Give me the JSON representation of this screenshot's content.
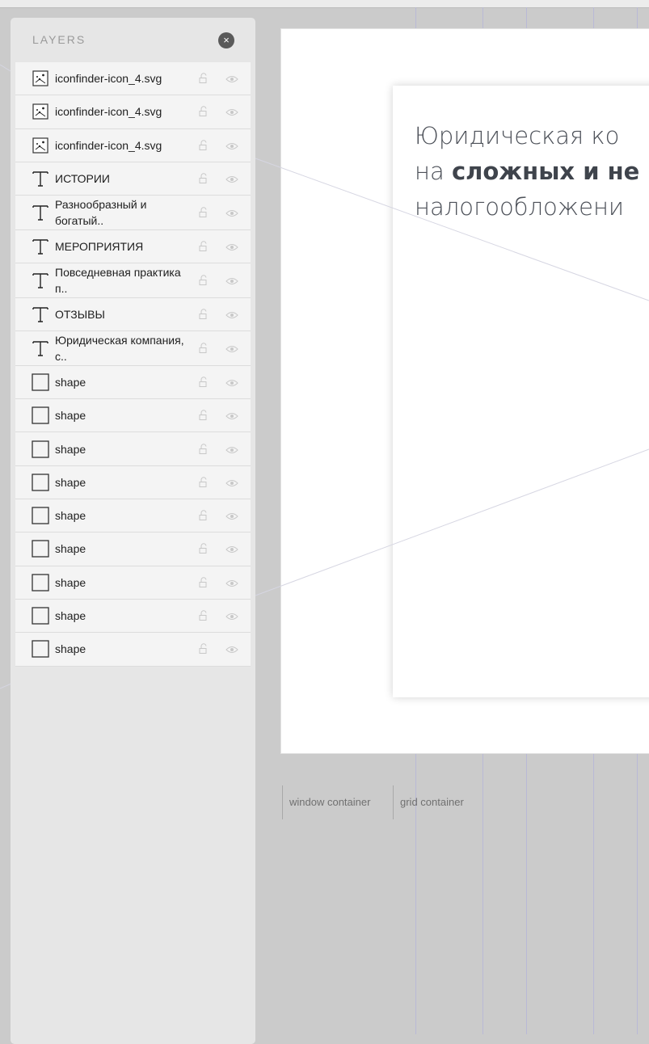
{
  "layers_panel": {
    "title": "LAYERS",
    "close_label": "×",
    "items": [
      {
        "type": "image",
        "icon": "image-file-icon",
        "name": "iconfinder-icon_4.svg"
      },
      {
        "type": "image",
        "icon": "image-file-icon",
        "name": "iconfinder-icon_4.svg"
      },
      {
        "type": "image",
        "icon": "image-file-icon",
        "name": "iconfinder-icon_4.svg"
      },
      {
        "type": "text",
        "icon": "text-icon",
        "name": "ИСТОРИИ"
      },
      {
        "type": "text",
        "icon": "text-icon",
        "name": "Разнообразный и богатый.."
      },
      {
        "type": "text",
        "icon": "text-icon",
        "name": "МЕРОПРИЯТИЯ"
      },
      {
        "type": "text",
        "icon": "text-icon",
        "name": "Повседневная практика п.."
      },
      {
        "type": "text",
        "icon": "text-icon",
        "name": "ОТЗЫВЫ"
      },
      {
        "type": "text",
        "icon": "text-icon",
        "name": "Юридическая компания, с.."
      },
      {
        "type": "shape",
        "icon": "shape-icon",
        "name": "shape"
      },
      {
        "type": "shape",
        "icon": "shape-icon",
        "name": "shape"
      },
      {
        "type": "shape",
        "icon": "shape-icon",
        "name": "shape"
      },
      {
        "type": "shape",
        "icon": "shape-icon",
        "name": "shape"
      },
      {
        "type": "shape",
        "icon": "shape-icon",
        "name": "shape"
      },
      {
        "type": "shape",
        "icon": "shape-icon",
        "name": "shape"
      },
      {
        "type": "shape",
        "icon": "shape-icon",
        "name": "shape"
      },
      {
        "type": "shape",
        "icon": "shape-icon",
        "name": "shape"
      },
      {
        "type": "shape",
        "icon": "shape-icon",
        "name": "shape"
      }
    ]
  },
  "canvas": {
    "headline": {
      "line1": "Юридическая ко",
      "line2_prefix": "на ",
      "line2_bold": "сложных и не",
      "line3": "налогообложени"
    },
    "window_container_label": "window container",
    "grid_container_label": "grid container"
  },
  "colors": {
    "canvas_bg": "#cbcbcb",
    "panel_bg": "#e6e6e6",
    "row_bg": "#f4f4f4",
    "grid_line": "#b9b9d6",
    "headline_text": "#4c5058"
  }
}
